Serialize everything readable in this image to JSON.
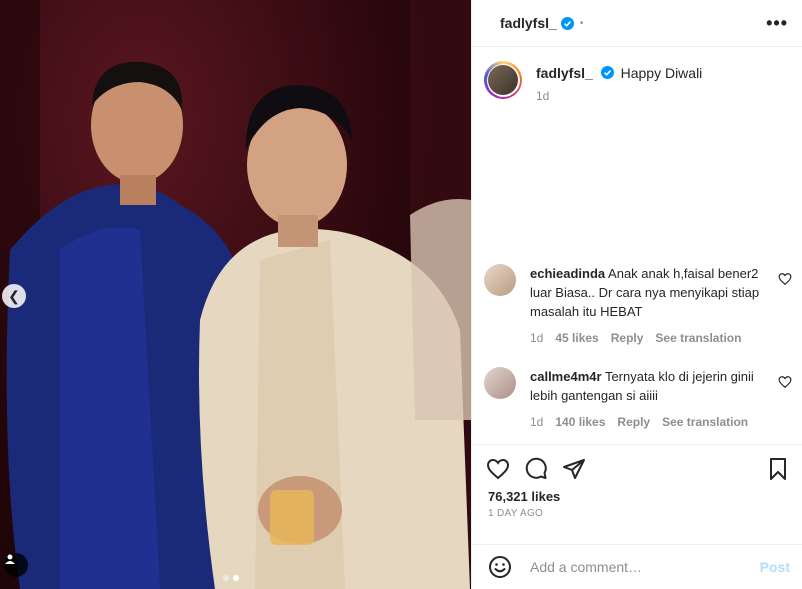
{
  "header": {
    "username": "fadlyfsl_",
    "separator": "•",
    "more": "•••"
  },
  "caption": {
    "username": "fadlyfsl_",
    "text": "Happy Diwali",
    "time": "1d"
  },
  "comments": [
    {
      "username": "echieadinda",
      "text": "Anak anak h,faisal bener2 luar Biasa.. Dr cara nya menyikapi stiap masalah itu HEBAT",
      "time": "1d",
      "likes": "45 likes",
      "reply": "Reply",
      "translate": "See translation"
    },
    {
      "username": "callme4m4r",
      "text": "Ternyata klo di jejerin ginii lebih gantengan si aiiii",
      "time": "1d",
      "likes": "140 likes",
      "reply": "Reply",
      "translate": "See translation"
    }
  ],
  "post": {
    "likes": "76,321 likes",
    "ago": "1 DAY AGO"
  },
  "add_comment": {
    "placeholder": "Add a comment…",
    "post_label": "Post"
  },
  "carousel": {
    "slides": 2,
    "active": 2
  },
  "icons": [
    "chevron-left-icon",
    "user-tag-icon",
    "verified-badge-icon",
    "more-icon",
    "heart-icon",
    "comment-icon",
    "share-icon",
    "bookmark-icon",
    "emoji-icon"
  ],
  "colors": {
    "verified": "#0095f6",
    "post_button": "#b2dffc",
    "muted": "#8e8e8e"
  }
}
